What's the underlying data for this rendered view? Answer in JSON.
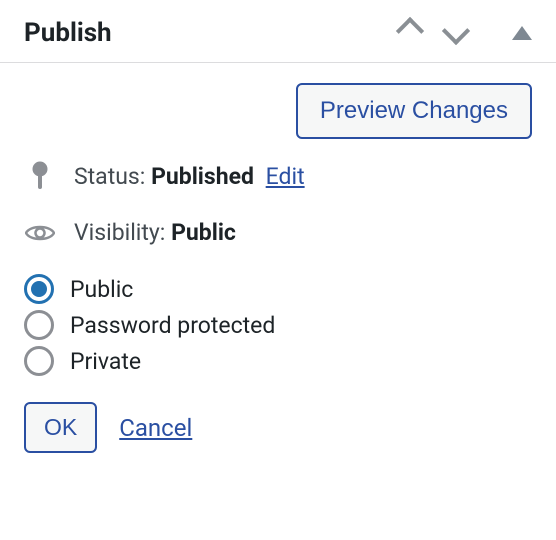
{
  "header": {
    "title": "Publish"
  },
  "preview": {
    "label": "Preview Changes"
  },
  "status": {
    "label": "Status:",
    "value": "Published",
    "edit": "Edit"
  },
  "visibility": {
    "label": "Visibility:",
    "value": "Public",
    "options": {
      "public": "Public",
      "password": "Password protected",
      "private": "Private"
    }
  },
  "actions": {
    "ok": "OK",
    "cancel": "Cancel"
  }
}
